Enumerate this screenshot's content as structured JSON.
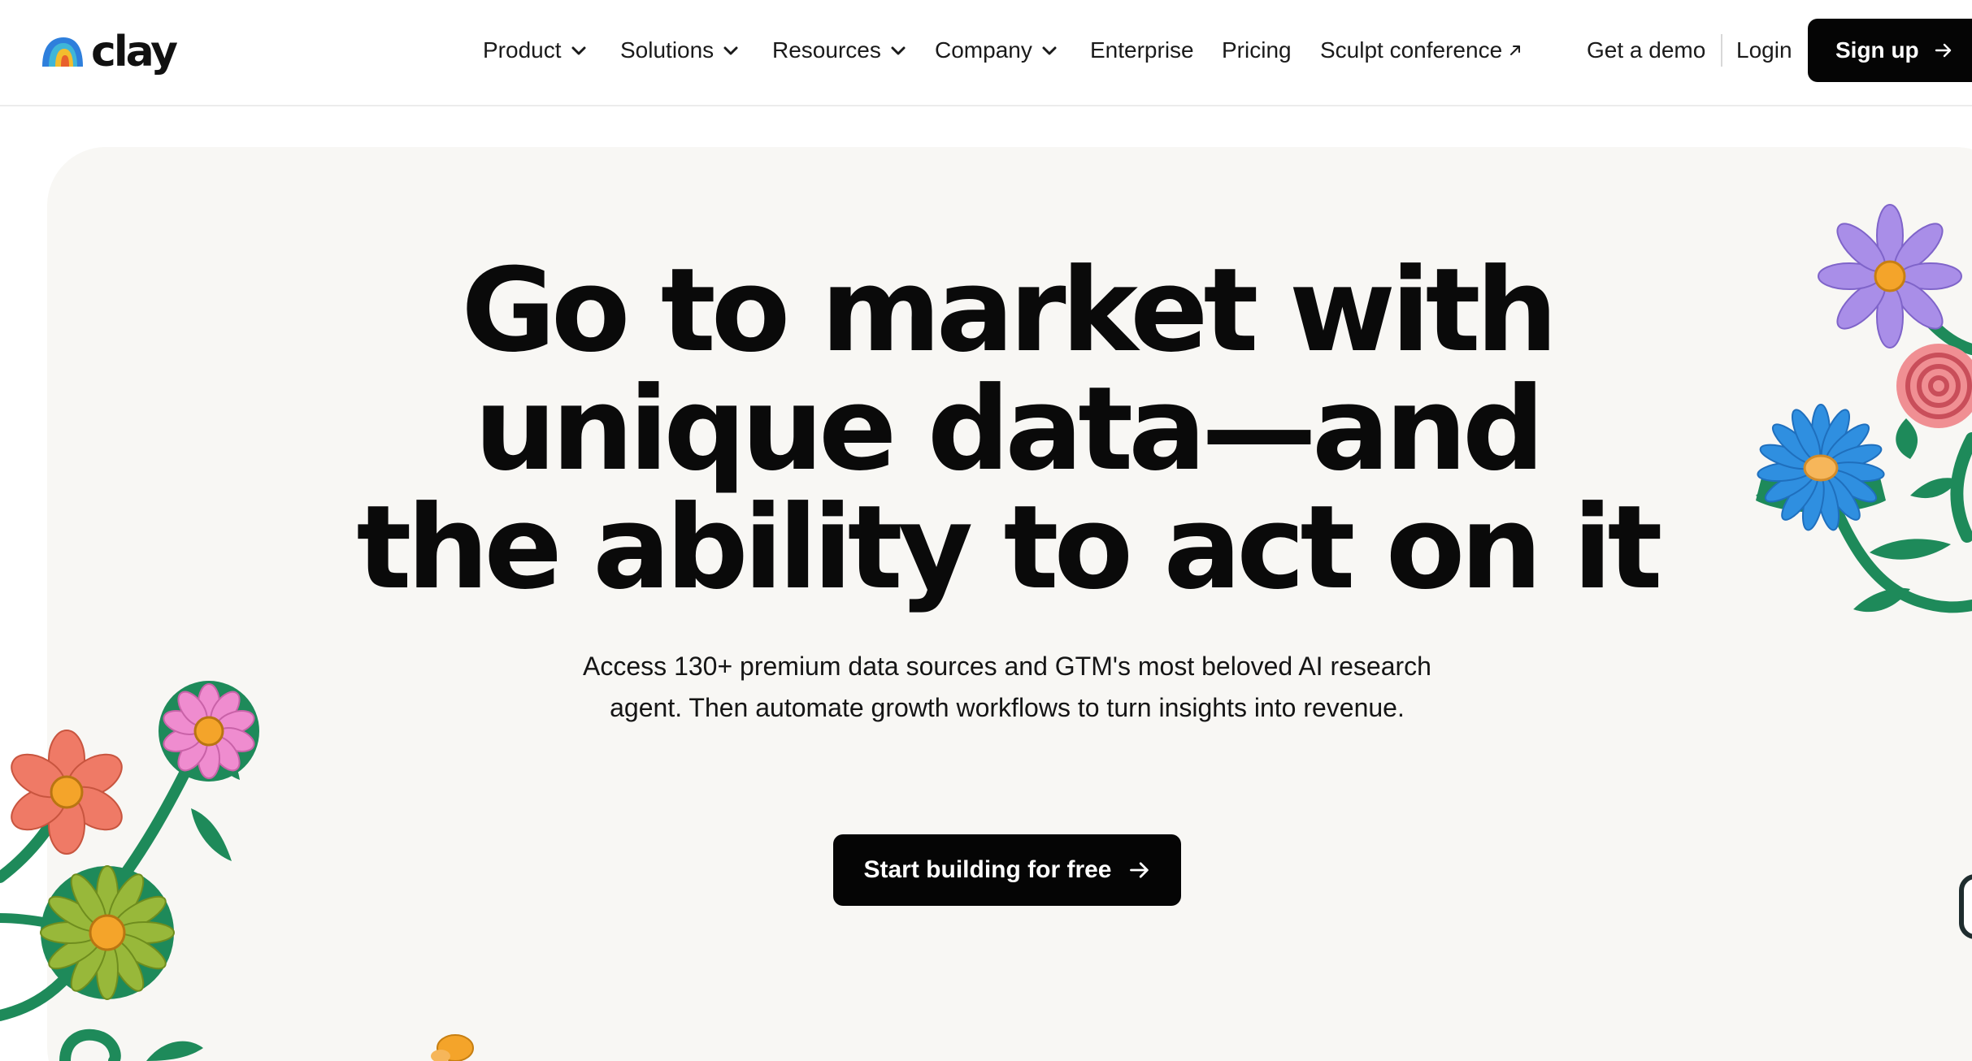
{
  "header": {
    "logo_text": "clay",
    "nav": [
      {
        "label": "Product",
        "has_dropdown": true
      },
      {
        "label": "Solutions",
        "has_dropdown": true
      },
      {
        "label": "Resources",
        "has_dropdown": true
      },
      {
        "label": "Company",
        "has_dropdown": true
      },
      {
        "label": "Enterprise",
        "has_dropdown": false
      },
      {
        "label": "Pricing",
        "has_dropdown": false
      },
      {
        "label": "Sculpt conference",
        "external": true
      }
    ],
    "get_demo": "Get a demo",
    "login": "Login",
    "signup": "Sign up"
  },
  "hero": {
    "title_lines": [
      "Go to market with",
      "unique data—and",
      "the ability to act on it"
    ],
    "subtitle": "Access 130+ premium data sources and GTM's most beloved AI research agent. Then automate growth workflows to turn insights into revenue.",
    "cta": "Start building for free"
  },
  "icons": {
    "dropdown": "chevron-down-icon",
    "external": "arrow-up-right-icon",
    "arrow": "arrow-right-icon"
  },
  "colors": {
    "primary_button": "#050505",
    "hero_background": "#f8f7f4",
    "stem": "#1e8a5a",
    "flower_purple": "#a98ee8",
    "flower_blue": "#2f8fe0",
    "flower_pink_rose": "#f08f93",
    "flower_coral": "#ef7a66",
    "flower_pink": "#ef8ccf",
    "flower_lime": "#98b83a",
    "flower_center": "#f4a42a"
  }
}
